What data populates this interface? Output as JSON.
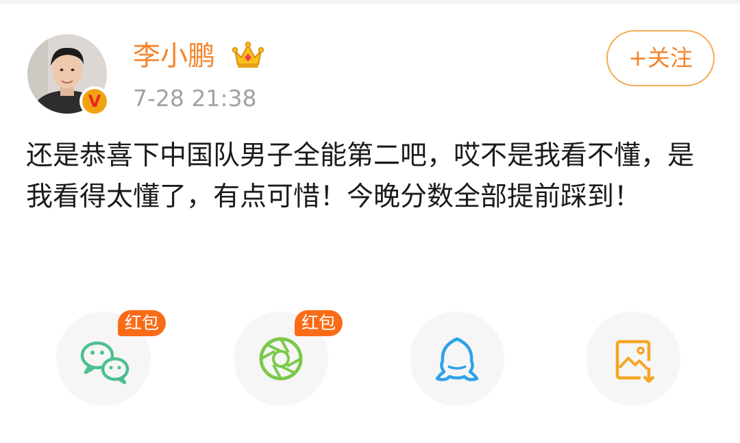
{
  "post": {
    "username": "李小鹏",
    "verified_label": "V",
    "timestamp": "7-28 21:38",
    "follow_label": "+关注",
    "text": "还是恭喜下中国队男子全能第二吧，哎不是我看不懂，是我看得太懂了，有点可惜！今晚分数全部提前踩到！"
  },
  "share": {
    "items": [
      {
        "icon": "wechat-icon",
        "badge": "红包",
        "color": "#4cc08e"
      },
      {
        "icon": "moments-icon",
        "badge": "红包",
        "color": "#7bc94a"
      },
      {
        "icon": "qq-icon",
        "color": "#2ea2e8"
      },
      {
        "icon": "save-image-icon",
        "color": "#f5a623"
      }
    ]
  },
  "colors": {
    "accent": "#f4842b",
    "badge": "#fa6b18",
    "timestamp": "#a2a2a2"
  }
}
